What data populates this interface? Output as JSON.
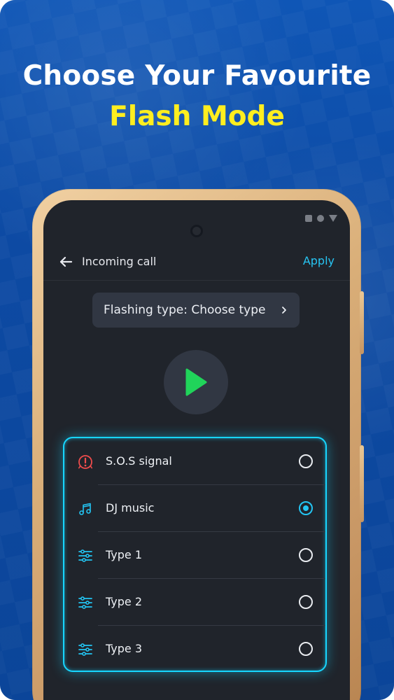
{
  "headline": {
    "line1": "Choose Your Favourite",
    "line2": "Flash Mode"
  },
  "screen": {
    "title": "Incoming call",
    "apply": "Apply",
    "chip": "Flashing type: Choose type"
  },
  "options": [
    {
      "label": "S.O.S signal",
      "icon": "warning-icon",
      "selected": false
    },
    {
      "label": "DJ music",
      "icon": "music-note-icon",
      "selected": true
    },
    {
      "label": "Type 1",
      "icon": "equalizer-icon",
      "selected": false
    },
    {
      "label": "Type 2",
      "icon": "equalizer-icon",
      "selected": false
    },
    {
      "label": "Type 3",
      "icon": "equalizer-icon",
      "selected": false
    }
  ],
  "colors": {
    "background": "#0d4aa3",
    "headline_white": "#ffffff",
    "headline_yellow": "#ffee1f",
    "accent": "#23c5f3",
    "play": "#20d45a",
    "warning": "#ef4c4c"
  }
}
